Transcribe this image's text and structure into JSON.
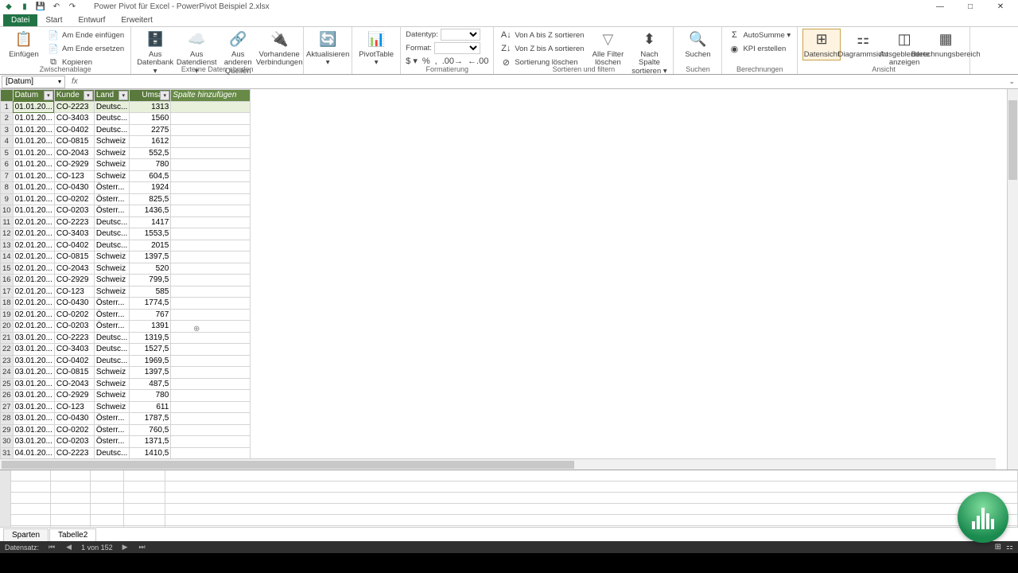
{
  "title": "Power Pivot für Excel - PowerPivot Beispiel 2.xlsx",
  "ribbon_tabs": {
    "datei": "Datei",
    "start": "Start",
    "entwurf": "Entwurf",
    "erweitert": "Erweitert"
  },
  "ribbon": {
    "clipboard": {
      "paste": "Einfügen",
      "paste_end": "Am Ende einfügen",
      "replace_end": "Am Ende ersetzen",
      "copy": "Kopieren",
      "group": "Zwischenablage"
    },
    "external": {
      "from_db": "Aus Datenbank ▾",
      "from_ds": "Aus Datendienst ▾",
      "from_other": "Aus anderen Quellen",
      "existing": "Vorhandene Verbindungen",
      "refresh": "Aktualisieren ▾",
      "pivot": "PivotTable ▾",
      "group": "Externe Daten abrufen"
    },
    "format": {
      "datatype": "Datentyp:",
      "format": "Format:",
      "group": "Formatierung"
    },
    "sort": {
      "az": "Von A bis Z sortieren",
      "za": "Von Z bis A sortieren",
      "clear": "Sortierung löschen",
      "filter_clear": "Alle Filter löschen",
      "by_col": "Nach Spalte sortieren ▾",
      "group": "Sortieren und filtern"
    },
    "find": {
      "find": "Suchen",
      "group": "Suchen"
    },
    "calc": {
      "autosum": "AutoSumme ▾",
      "kpi": "KPI erstellen",
      "group": "Berechnungen"
    },
    "view": {
      "data": "Datensicht",
      "diagram": "Diagrammsicht",
      "hidden": "Ausgeblendete anzeigen",
      "calc_area": "Berechnungsbereich",
      "group": "Ansicht"
    }
  },
  "name_box": "[Datum]",
  "fx": "fx",
  "columns": {
    "datum": "Datum",
    "kunde": "Kunde",
    "land": "Land",
    "umsatz": "Umsatz",
    "add": "Spalte hinzufügen"
  },
  "rows": [
    {
      "n": 1,
      "d": "01.01.20...",
      "k": "CO-2223",
      "l": "Deutsc...",
      "u": "1313"
    },
    {
      "n": 2,
      "d": "01.01.20...",
      "k": "CO-3403",
      "l": "Deutsc...",
      "u": "1560"
    },
    {
      "n": 3,
      "d": "01.01.20...",
      "k": "CO-0402",
      "l": "Deutsc...",
      "u": "2275"
    },
    {
      "n": 4,
      "d": "01.01.20...",
      "k": "CO-0815",
      "l": "Schweiz",
      "u": "1612"
    },
    {
      "n": 5,
      "d": "01.01.20...",
      "k": "CO-2043",
      "l": "Schweiz",
      "u": "552,5"
    },
    {
      "n": 6,
      "d": "01.01.20...",
      "k": "CO-2929",
      "l": "Schweiz",
      "u": "780"
    },
    {
      "n": 7,
      "d": "01.01.20...",
      "k": "CO-123",
      "l": "Schweiz",
      "u": "604,5"
    },
    {
      "n": 8,
      "d": "01.01.20...",
      "k": "CO-0430",
      "l": "Österr...",
      "u": "1924"
    },
    {
      "n": 9,
      "d": "01.01.20...",
      "k": "CO-0202",
      "l": "Österr...",
      "u": "825,5"
    },
    {
      "n": 10,
      "d": "01.01.20...",
      "k": "CO-0203",
      "l": "Österr...",
      "u": "1436,5"
    },
    {
      "n": 11,
      "d": "02.01.20...",
      "k": "CO-2223",
      "l": "Deutsc...",
      "u": "1417"
    },
    {
      "n": 12,
      "d": "02.01.20...",
      "k": "CO-3403",
      "l": "Deutsc...",
      "u": "1553,5"
    },
    {
      "n": 13,
      "d": "02.01.20...",
      "k": "CO-0402",
      "l": "Deutsc...",
      "u": "2015"
    },
    {
      "n": 14,
      "d": "02.01.20...",
      "k": "CO-0815",
      "l": "Schweiz",
      "u": "1397,5"
    },
    {
      "n": 15,
      "d": "02.01.20...",
      "k": "CO-2043",
      "l": "Schweiz",
      "u": "520"
    },
    {
      "n": 16,
      "d": "02.01.20...",
      "k": "CO-2929",
      "l": "Schweiz",
      "u": "799,5"
    },
    {
      "n": 17,
      "d": "02.01.20...",
      "k": "CO-123",
      "l": "Schweiz",
      "u": "585"
    },
    {
      "n": 18,
      "d": "02.01.20...",
      "k": "CO-0430",
      "l": "Österr...",
      "u": "1774,5"
    },
    {
      "n": 19,
      "d": "02.01.20...",
      "k": "CO-0202",
      "l": "Österr...",
      "u": "767"
    },
    {
      "n": 20,
      "d": "02.01.20...",
      "k": "CO-0203",
      "l": "Österr...",
      "u": "1391"
    },
    {
      "n": 21,
      "d": "03.01.20...",
      "k": "CO-2223",
      "l": "Deutsc...",
      "u": "1319,5"
    },
    {
      "n": 22,
      "d": "03.01.20...",
      "k": "CO-3403",
      "l": "Deutsc...",
      "u": "1527,5"
    },
    {
      "n": 23,
      "d": "03.01.20...",
      "k": "CO-0402",
      "l": "Deutsc...",
      "u": "1969,5"
    },
    {
      "n": 24,
      "d": "03.01.20...",
      "k": "CO-0815",
      "l": "Schweiz",
      "u": "1397,5"
    },
    {
      "n": 25,
      "d": "03.01.20...",
      "k": "CO-2043",
      "l": "Schweiz",
      "u": "487,5"
    },
    {
      "n": 26,
      "d": "03.01.20...",
      "k": "CO-2929",
      "l": "Schweiz",
      "u": "780"
    },
    {
      "n": 27,
      "d": "03.01.20...",
      "k": "CO-123",
      "l": "Schweiz",
      "u": "611"
    },
    {
      "n": 28,
      "d": "03.01.20...",
      "k": "CO-0430",
      "l": "Österr...",
      "u": "1787,5"
    },
    {
      "n": 29,
      "d": "03.01.20...",
      "k": "CO-0202",
      "l": "Österr...",
      "u": "760,5"
    },
    {
      "n": 30,
      "d": "03.01.20...",
      "k": "CO-0203",
      "l": "Österr...",
      "u": "1371,5"
    },
    {
      "n": 31,
      "d": "04.01.20...",
      "k": "CO-2223",
      "l": "Deutsc...",
      "u": "1410,5"
    }
  ],
  "sheet_tabs": {
    "sparten": "Sparten",
    "tabelle2": "Tabelle2"
  },
  "status": {
    "label": "Datensatz:",
    "pos": "1 von 152"
  }
}
